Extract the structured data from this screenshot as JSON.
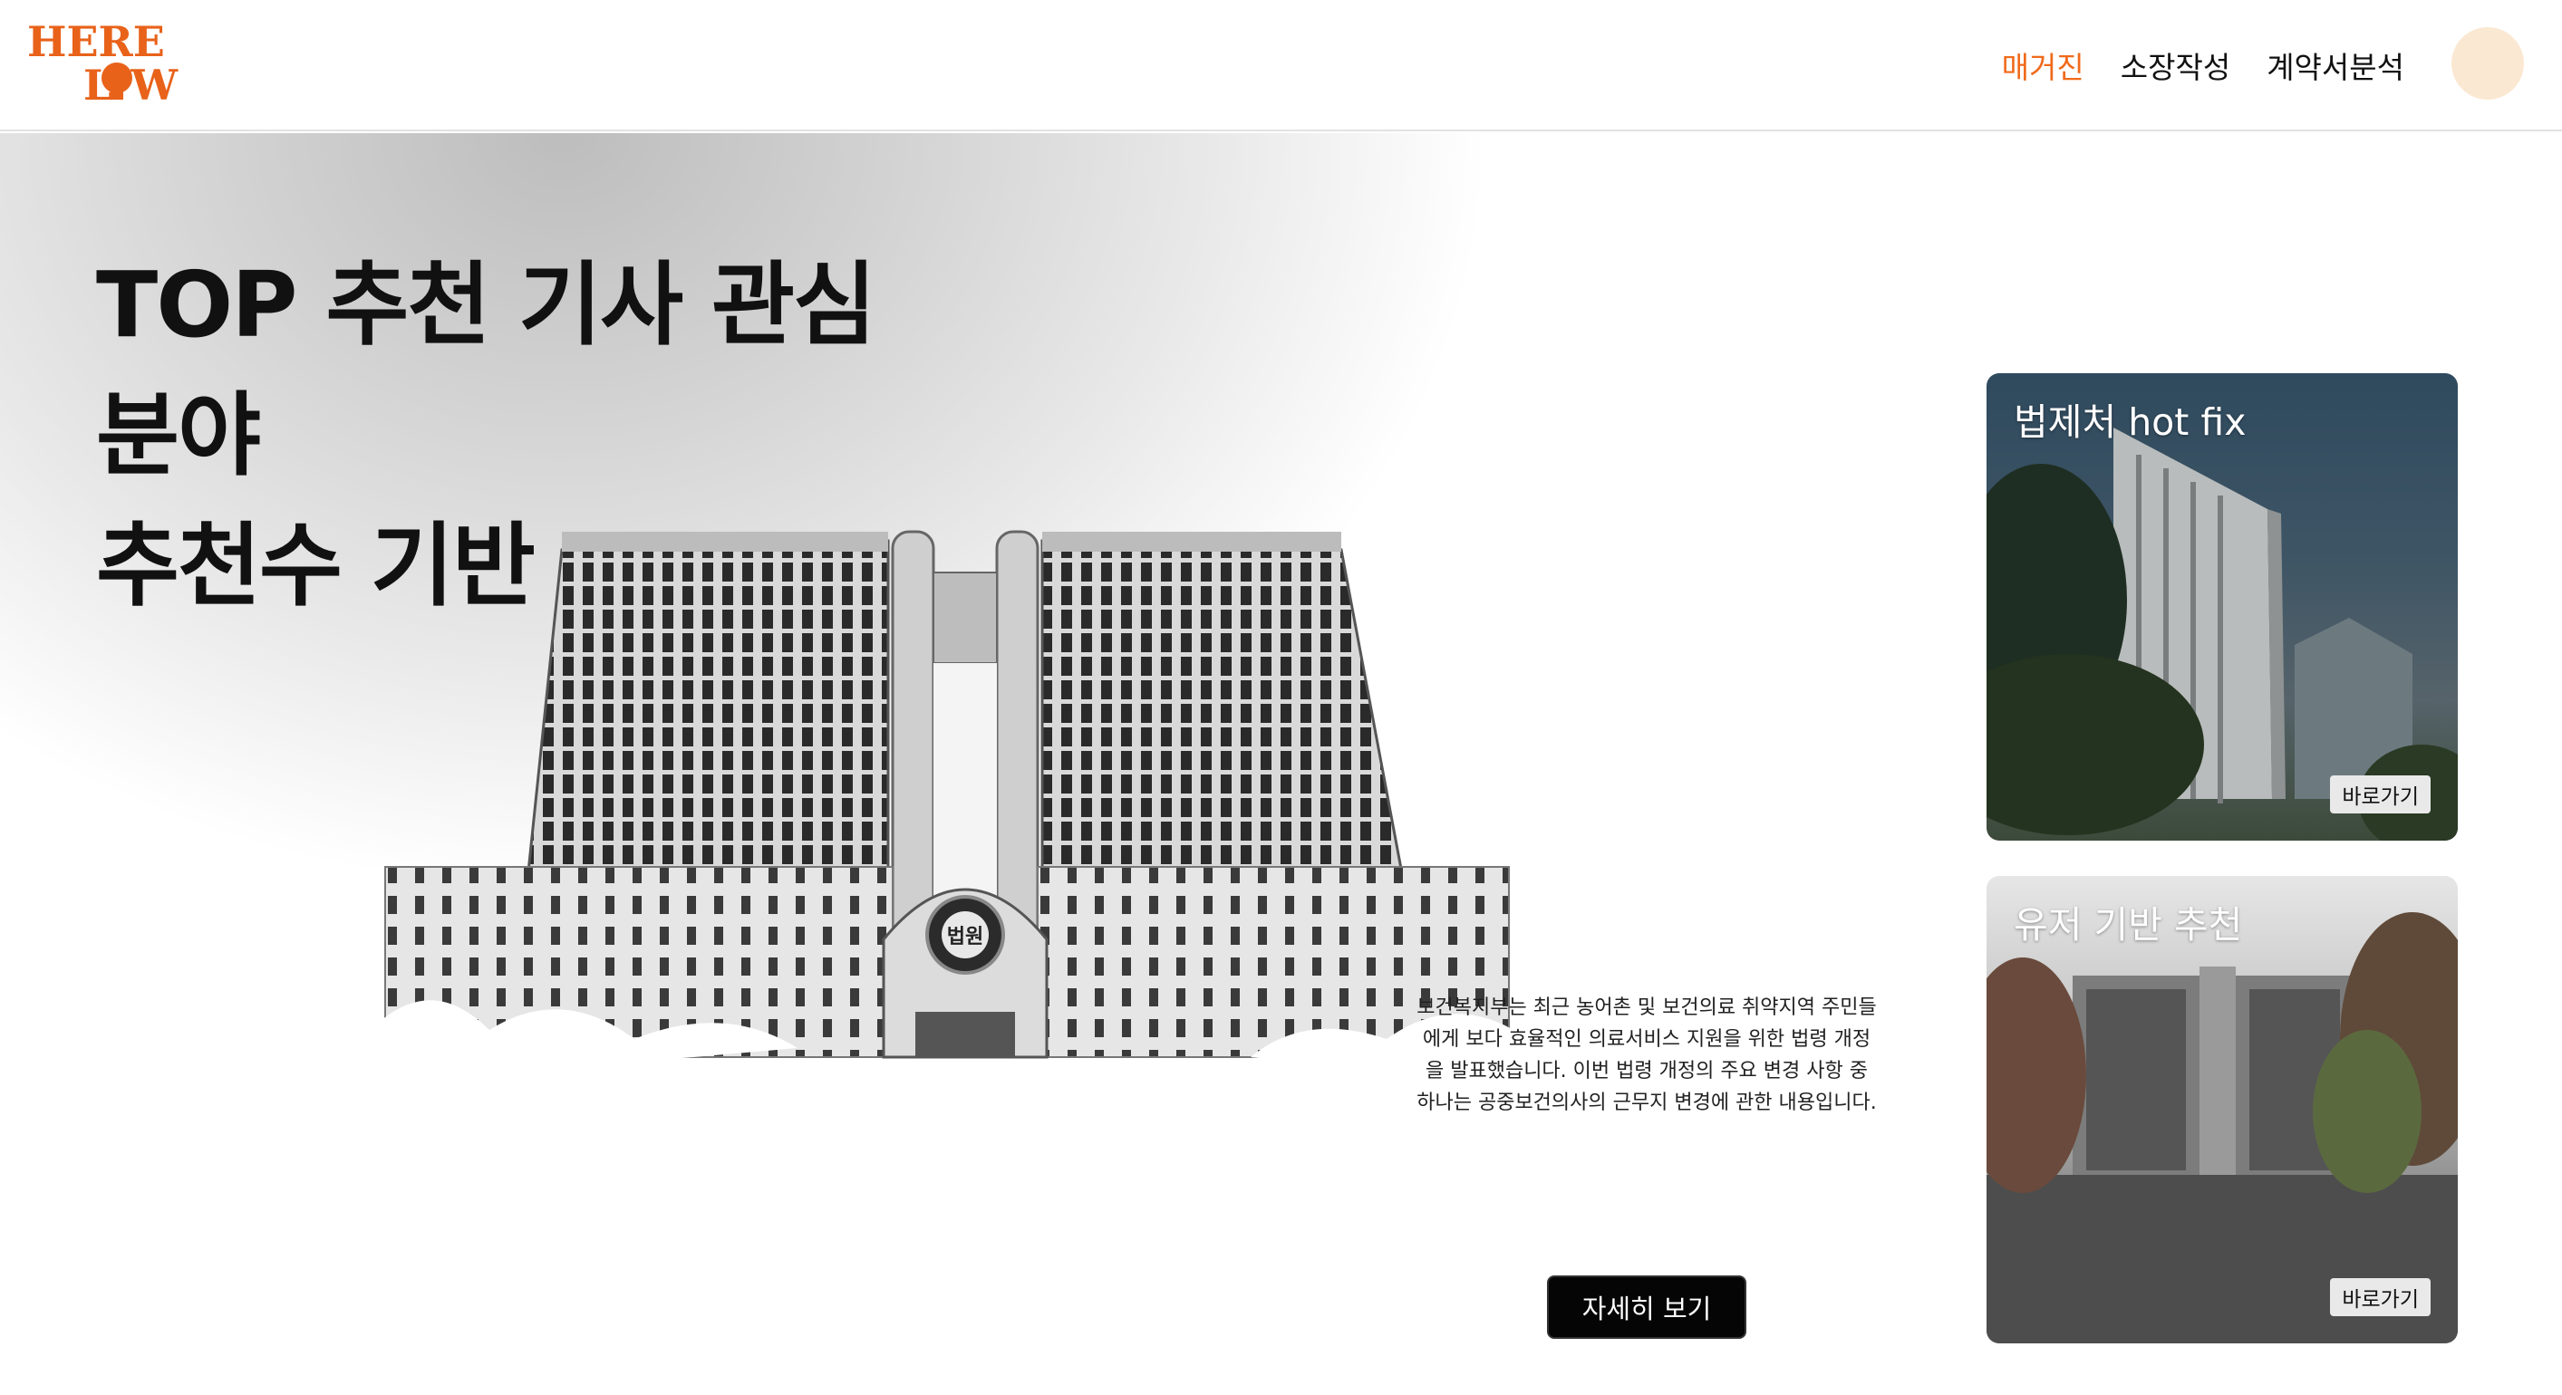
{
  "brand": {
    "logo_top": "HERE",
    "logo_bottom": "LAW",
    "accent_color": "#f06a1a"
  },
  "nav": {
    "items": [
      {
        "label": "매거진",
        "active": true
      },
      {
        "label": "소장작성",
        "active": false
      },
      {
        "label": "계약서분석",
        "active": false
      }
    ]
  },
  "hero": {
    "title_lines": [
      "TOP 추천 기사 관심",
      "분야",
      "추천수 기반"
    ],
    "article_excerpt": "보건복지부는 최근 농어촌 및 보건의료 취약지역 주민들에게 보다 효율적인 의료서비스 지원을 위한 법령 개정을 발표했습니다. 이번 법령 개정의 주요 변경 사항 중 하나는 공중보건의사의 근무지 변경에 관한 내용입니다.",
    "detail_button": "자세히 보기",
    "building_sign": "법원"
  },
  "cards": [
    {
      "title": "법제처 hot fix",
      "link_label": "바로가기"
    },
    {
      "title": "유저 기반 추천",
      "link_label": "바로가기"
    }
  ]
}
